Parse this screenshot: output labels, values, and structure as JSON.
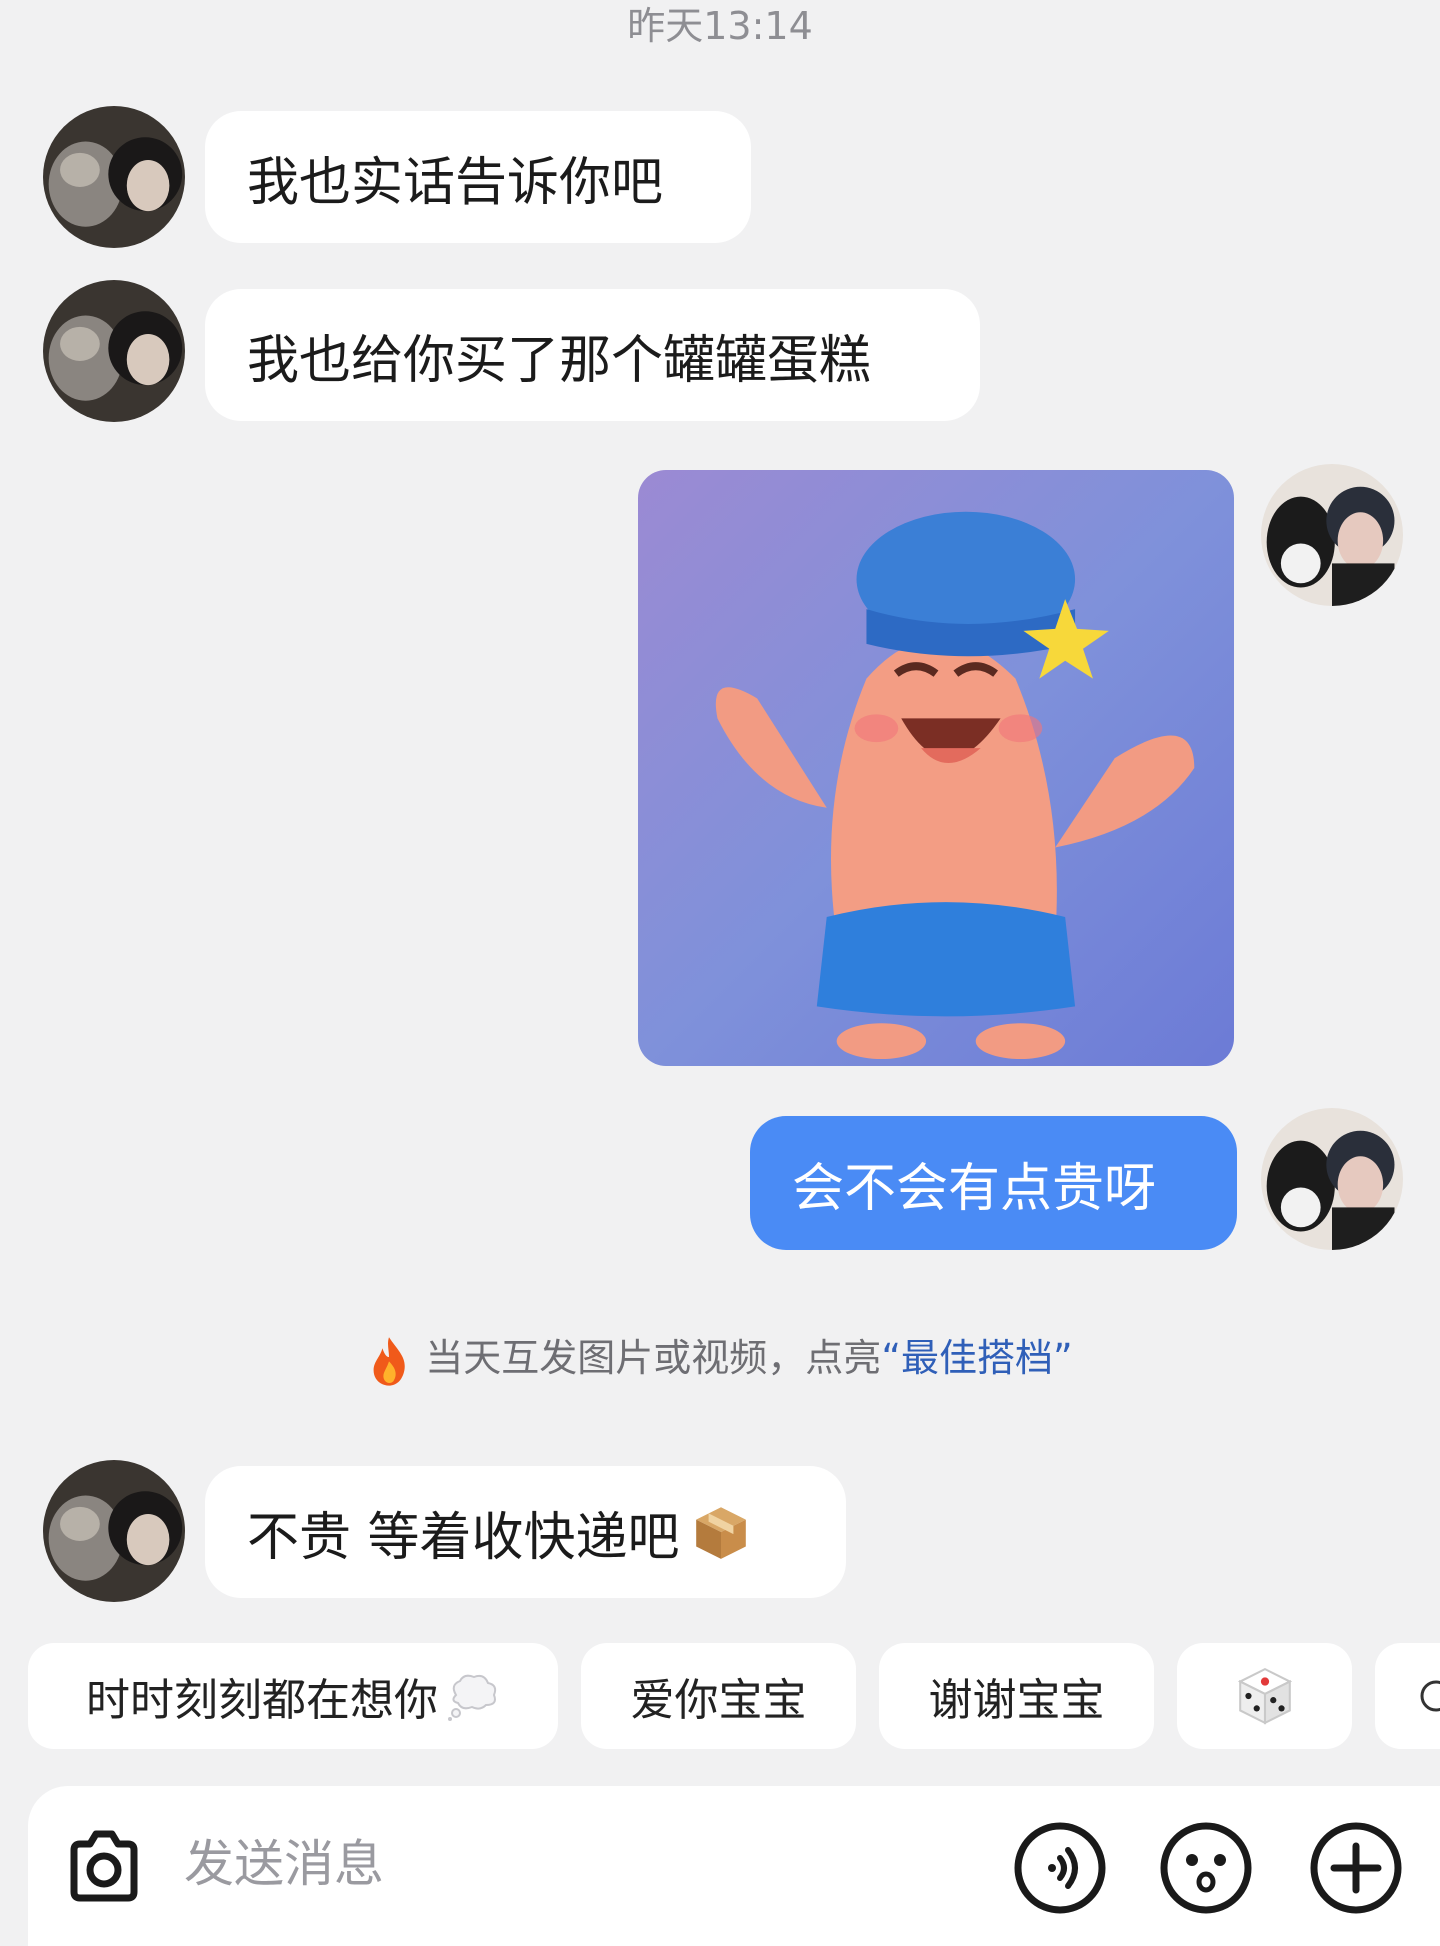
{
  "header": {
    "timestamp": "昨天13:14"
  },
  "messages": [
    {
      "sender": "other",
      "text": "我也实话告诉你吧"
    },
    {
      "sender": "other",
      "text": "我也给你买了那个罐罐蛋糕"
    },
    {
      "sender": "me",
      "type": "image",
      "image": "patrick-star-sticker"
    },
    {
      "sender": "me",
      "text": "会不会有点贵呀"
    },
    {
      "sender": "other",
      "text": "不贵 等着收快递吧",
      "emoji": "package-icon"
    }
  ],
  "hint": {
    "prefix": "当天互发图片或视频，点亮",
    "highlight": "“最佳搭档”",
    "icon": "fire-icon"
  },
  "quick_replies": [
    {
      "label": "时时刻刻都在想你",
      "icon": "thought-bubble-icon"
    },
    {
      "label": "爱你宝宝"
    },
    {
      "label": "谢谢宝宝"
    },
    {
      "label": "",
      "icon": "dice-icon"
    }
  ],
  "input": {
    "placeholder": "发送消息"
  },
  "colors": {
    "background": "#f1f1f2",
    "my_bubble": "#4a8bf5",
    "highlight": "#2f5fb8"
  }
}
